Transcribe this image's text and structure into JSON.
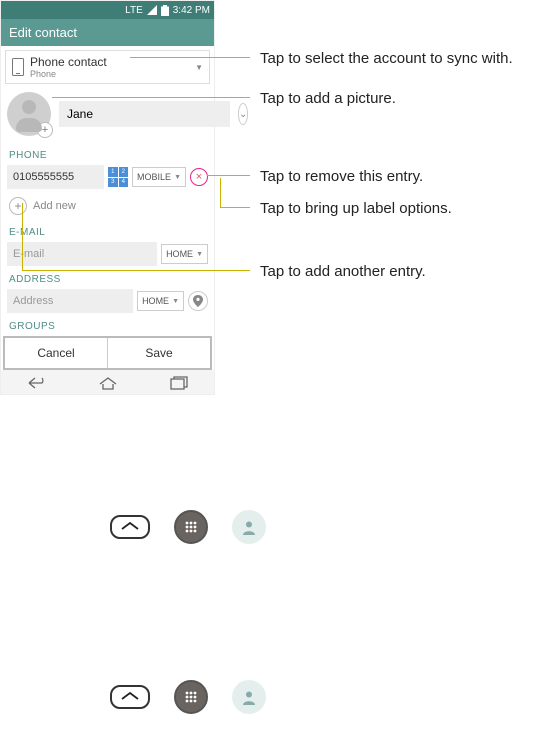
{
  "status": {
    "net": "LTE",
    "time": "3:42 PM"
  },
  "title": "Edit contact",
  "account": {
    "main": "Phone contact",
    "sub": "Phone"
  },
  "name": {
    "value": "Jane"
  },
  "sections": {
    "phone": "PHONE",
    "email": "E-MAIL",
    "address": "ADDRESS",
    "groups": "GROUPS"
  },
  "phone_entry": {
    "value": "0105555555",
    "type": "MOBILE"
  },
  "add_new": "Add new",
  "email_entry": {
    "placeholder": "E-mail",
    "type": "HOME"
  },
  "address_entry": {
    "placeholder": "Address",
    "type": "HOME"
  },
  "buttons": {
    "cancel": "Cancel",
    "save": "Save"
  },
  "callouts": {
    "account": "Tap to select the account to sync with.",
    "picture": "Tap to add a picture.",
    "remove": "Tap to remove this entry.",
    "label": "Tap to bring up label options.",
    "addnew": "Tap to add another entry."
  }
}
